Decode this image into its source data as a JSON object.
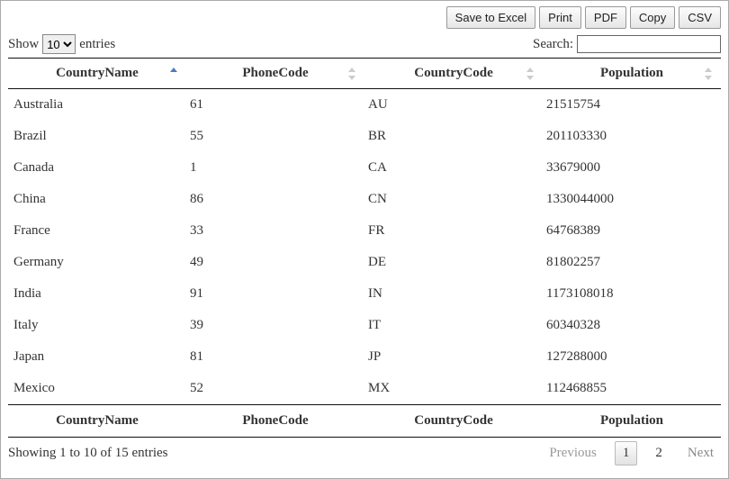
{
  "toolbar": {
    "save_excel": "Save to Excel",
    "print": "Print",
    "pdf": "PDF",
    "copy": "Copy",
    "csv": "CSV"
  },
  "length": {
    "prefix": "Show",
    "suffix": "entries",
    "value": "10"
  },
  "search": {
    "label": "Search:",
    "value": ""
  },
  "columns": {
    "c0": "CountryName",
    "c1": "PhoneCode",
    "c2": "CountryCode",
    "c3": "Population"
  },
  "rows": [
    {
      "name": "Australia",
      "phone": "61",
      "code": "AU",
      "pop": "21515754"
    },
    {
      "name": "Brazil",
      "phone": "55",
      "code": "BR",
      "pop": "201103330"
    },
    {
      "name": "Canada",
      "phone": "1",
      "code": "CA",
      "pop": "33679000"
    },
    {
      "name": "China",
      "phone": "86",
      "code": "CN",
      "pop": "1330044000"
    },
    {
      "name": "France",
      "phone": "33",
      "code": "FR",
      "pop": "64768389"
    },
    {
      "name": "Germany",
      "phone": "49",
      "code": "DE",
      "pop": "81802257"
    },
    {
      "name": "India",
      "phone": "91",
      "code": "IN",
      "pop": "1173108018"
    },
    {
      "name": "Italy",
      "phone": "39",
      "code": "IT",
      "pop": "60340328"
    },
    {
      "name": "Japan",
      "phone": "81",
      "code": "JP",
      "pop": "127288000"
    },
    {
      "name": "Mexico",
      "phone": "52",
      "code": "MX",
      "pop": "112468855"
    }
  ],
  "info": "Showing 1 to 10 of 15 entries",
  "pagination": {
    "previous": "Previous",
    "next": "Next",
    "page1": "1",
    "page2": "2"
  }
}
